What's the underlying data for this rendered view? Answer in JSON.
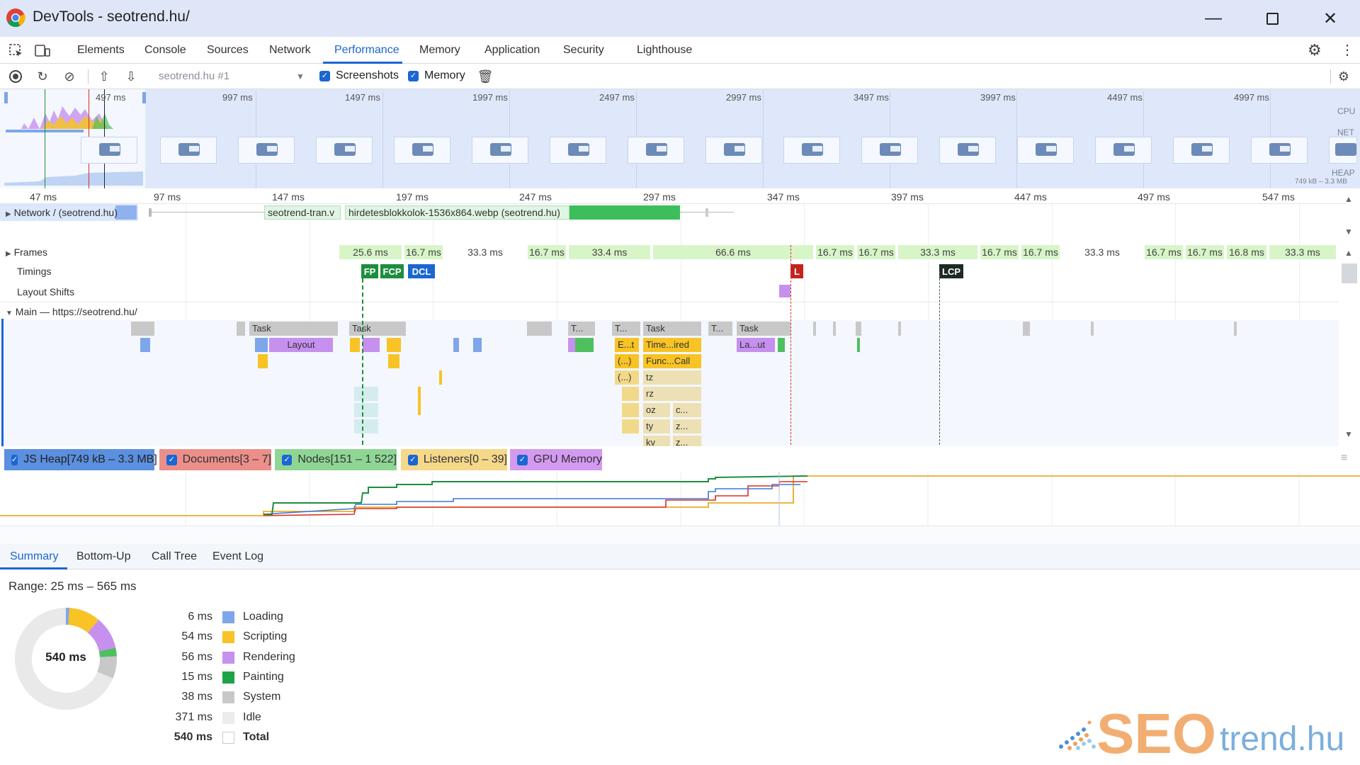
{
  "window": {
    "title": "DevTools - seotrend.hu/"
  },
  "tabs": [
    "Elements",
    "Console",
    "Sources",
    "Network",
    "Performance",
    "Memory",
    "Application",
    "Security",
    "Lighthouse"
  ],
  "toolbar": {
    "profile_select": "seotrend.hu #1",
    "screenshots_label": "Screenshots",
    "memory_label": "Memory"
  },
  "overview": {
    "ticks": [
      "497 ms",
      "997 ms",
      "1497 ms",
      "1997 ms",
      "2497 ms",
      "2997 ms",
      "3497 ms",
      "3997 ms",
      "4497 ms",
      "4997 ms"
    ],
    "side_labels": {
      "cpu": "CPU",
      "net": "NET",
      "heap": "HEAP",
      "heap_range": "749 kB – 3.3 MB"
    }
  },
  "ruler": {
    "ticks": [
      "47 ms",
      "97 ms",
      "147 ms",
      "197 ms",
      "247 ms",
      "297 ms",
      "347 ms",
      "397 ms",
      "447 ms",
      "497 ms",
      "547 ms"
    ]
  },
  "tracks": {
    "network": {
      "label": "Network / (seotrend.hu)",
      "req1": "seotrend-tran.v",
      "req2": "hirdetesblokkolok-1536x864.webp (seotrend.hu)"
    },
    "frames_label": "Frames",
    "timings_label": "Timings",
    "layout_shifts_label": "Layout Shifts",
    "main_label": "Main — https://seotrend.hu/",
    "frames": [
      "25.6 ms",
      "16.7 ms",
      "33.3 ms",
      "16.7 ms",
      "33.4 ms",
      "66.6 ms",
      "16.7 ms",
      "16.7 ms",
      "33.3 ms",
      "16.7 ms",
      "16.7 ms",
      "33.3 ms",
      "16.7 ms",
      "16.7 ms",
      "16.8 ms",
      "33.3 ms"
    ],
    "markers": {
      "fp": "FP",
      "fcp": "FCP",
      "dcl": "DCL",
      "l": "L",
      "lcp": "LCP"
    },
    "flame": {
      "task": "Task",
      "t_short": "T...",
      "t_dots": "T...",
      "layout": "Layout",
      "e_t": "E...t",
      "timer": "Time...ired",
      "la_ut": "La...ut",
      "paren": "(...)",
      "func": "Func...Call",
      "tz": "tz",
      "rz": "rz",
      "oz": "oz",
      "ty": "ty",
      "kv": "kv",
      "c": "c...",
      "z": "z..."
    }
  },
  "memory_legend": [
    "JS Heap[749 kB – 3.3 MB]",
    "Documents[3 – 7]",
    "Nodes[151 – 1 522]",
    "Listeners[0 – 39]",
    "GPU Memory"
  ],
  "memory_colors": {
    "js_heap": "#3c78d8",
    "documents": "#d93025",
    "nodes": "#1e8e3e",
    "listeners": "#e3a008",
    "gpu": "#9334e6"
  },
  "summary": {
    "tabs": [
      "Summary",
      "Bottom-Up",
      "Call Tree",
      "Event Log"
    ],
    "range": "Range: 25 ms – 565 ms",
    "donut_label": "540 ms",
    "rows": [
      {
        "value": "6 ms",
        "label": "Loading",
        "color": "#7ea6ea"
      },
      {
        "value": "54 ms",
        "label": "Scripting",
        "color": "#f7c325"
      },
      {
        "value": "56 ms",
        "label": "Rendering",
        "color": "#c690ef"
      },
      {
        "value": "15 ms",
        "label": "Painting",
        "color": "#4fbf5f"
      },
      {
        "value": "38 ms",
        "label": "System",
        "color": "#c8c8c8"
      },
      {
        "value": "371 ms",
        "label": "Idle",
        "color": "#e6e6e6"
      },
      {
        "value": "540 ms",
        "label": "Total",
        "color": "#ffffff"
      }
    ],
    "donut_ms": [
      6,
      54,
      56,
      15,
      38,
      371
    ]
  },
  "watermark": {
    "seo": "SEO",
    "trend": "trend.hu"
  }
}
